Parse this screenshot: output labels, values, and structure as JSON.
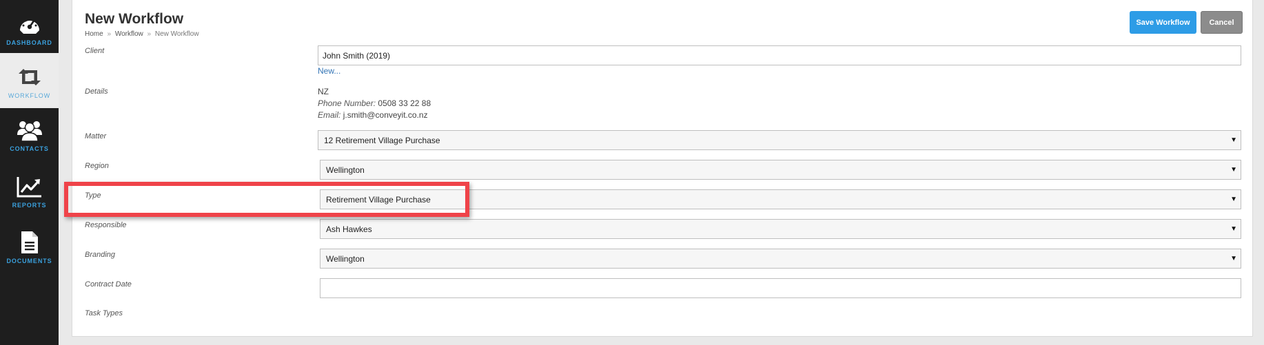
{
  "sidebar": {
    "items": [
      {
        "label": "DASHBOARD",
        "icon": "speedometer-icon",
        "active": false
      },
      {
        "label": "WORKFLOW",
        "icon": "retweet-icon",
        "active": true
      },
      {
        "label": "CONTACTS",
        "icon": "users-icon",
        "active": false
      },
      {
        "label": "REPORTS",
        "icon": "line-chart-icon",
        "active": false
      },
      {
        "label": "DOCUMENTS",
        "icon": "document-icon",
        "active": false
      }
    ]
  },
  "header": {
    "title": "New Workflow",
    "breadcrumb": [
      "Home",
      "Workflow",
      "New Workflow"
    ],
    "breadcrumb_sep": "»",
    "save_label": "Save Workflow",
    "cancel_label": "Cancel"
  },
  "form": {
    "client": {
      "label": "Client",
      "value": "John Smith (2019)",
      "new_link": "New..."
    },
    "details": {
      "label": "Details",
      "country": "NZ",
      "phone_label": "Phone Number:",
      "phone": "0508 33 22 88",
      "email_label": "Email:",
      "email": "j.smith@conveyit.co.nz"
    },
    "matter": {
      "label": "Matter",
      "value": "12 Retirement Village Purchase"
    },
    "region": {
      "label": "Region",
      "value": "Wellington"
    },
    "type": {
      "label": "Type",
      "value": "Retirement Village Purchase"
    },
    "responsible": {
      "label": "Responsible",
      "value": "Ash Hawkes"
    },
    "branding": {
      "label": "Branding",
      "value": "Wellington"
    },
    "contract_date": {
      "label": "Contract Date",
      "value": ""
    },
    "task_types": {
      "label": "Task Types"
    }
  },
  "colors": {
    "accent": "#2d9ce6",
    "sidebar_bg": "#1e1e1e",
    "sidebar_label": "#3aa0dd",
    "highlight": "#ef4349",
    "link": "#3475b5"
  }
}
